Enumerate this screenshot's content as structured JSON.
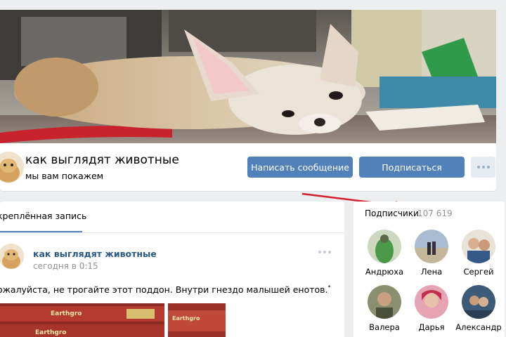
{
  "group": {
    "name": "как выглядят животные",
    "status": "мы вам покажем"
  },
  "actions": {
    "message_label": "Написать сообщение",
    "subscribe_label": "Подписаться",
    "more_icon": "more-dots-icon"
  },
  "wall": {
    "tab_label": "крeплённая запись",
    "post": {
      "author": "как выглядят животные",
      "date": "сегодня в 0:15",
      "text": "ожалуйста, не трогайте этот поддон. Внутри гнездо малышей енотов.",
      "image1_label": "Earthgro",
      "image2_label": "Earthgro"
    }
  },
  "subscribers": {
    "title": "Подписчики",
    "count": "107 619",
    "members": [
      {
        "name": "Андрюха",
        "color": "#4a9a4a"
      },
      {
        "name": "Лена",
        "color": "#7f9ab5"
      },
      {
        "name": "Сергей",
        "color": "#c8a88a"
      },
      {
        "name": "Валера",
        "color": "#6d7a5a"
      },
      {
        "name": "Дарья",
        "color": "#c0506a"
      },
      {
        "name": "Александр",
        "color": "#3d5a78"
      }
    ]
  },
  "colors": {
    "accent": "#5181b8",
    "link": "#2a5885",
    "arrow": "#d11f2b"
  }
}
